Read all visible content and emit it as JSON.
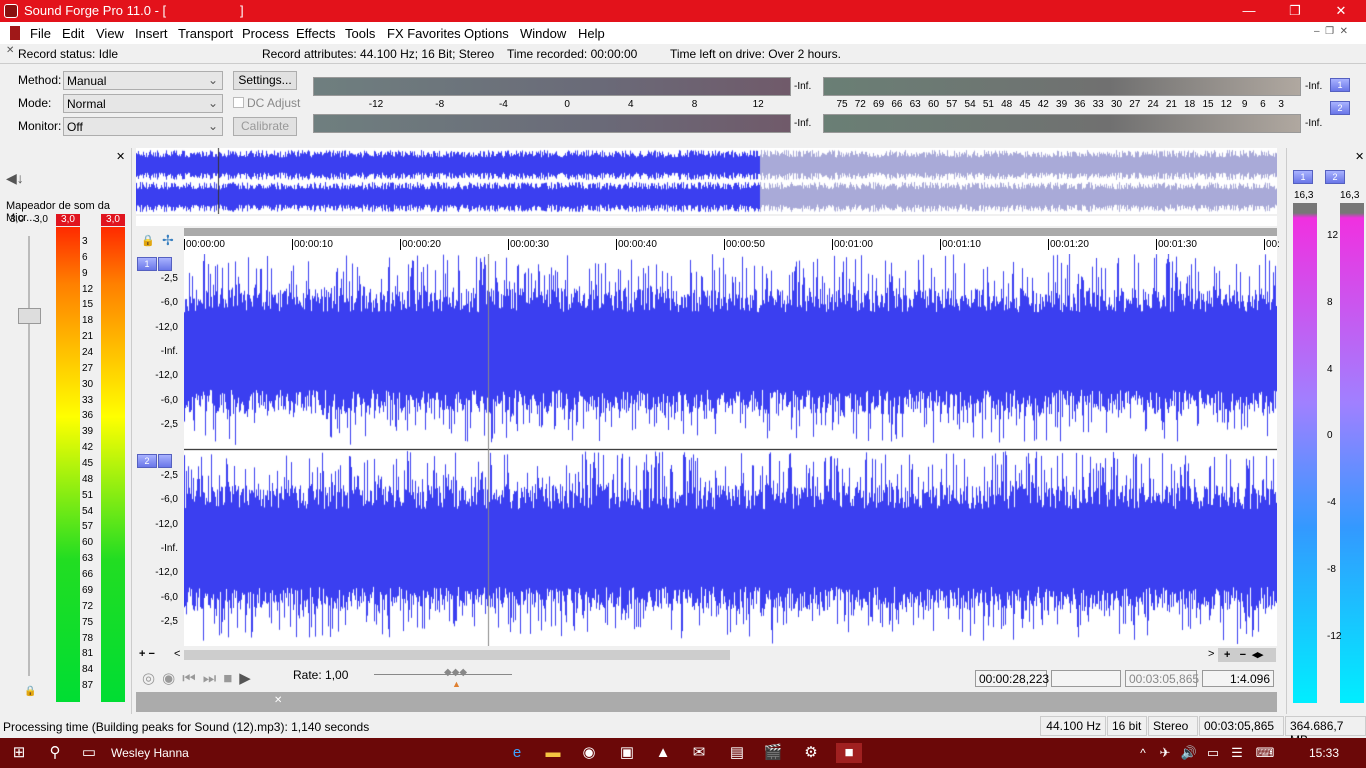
{
  "app": {
    "title": "Sound Forge Pro 11.0 - [",
    "title_end": "]",
    "icon": "sound-forge-icon"
  },
  "window_controls": {
    "minimize": "—",
    "restore": "❐",
    "close": "✕"
  },
  "menu": [
    "File",
    "Edit",
    "View",
    "Insert",
    "Transport",
    "Process",
    "Effects",
    "Tools",
    "FX Favorites",
    "Options",
    "Window",
    "Help"
  ],
  "record": {
    "status": "Record status: Idle",
    "attributes": "Record attributes: 44.100 Hz; 16 Bit; Stereo",
    "time_recorded": "Time recorded: 00:00:00",
    "time_left": "Time left on drive: Over 2 hours.",
    "method_label": "Method:",
    "method": "Manual",
    "mode_label": "Mode:",
    "mode": "Normal",
    "monitor_label": "Monitor:",
    "monitor": "Off",
    "settings": "Settings...",
    "dc_adjust": "DC Adjust",
    "calibrate": "Calibrate",
    "meter_inf": "-Inf.",
    "scale_left": [
      "-12",
      "-8",
      "-4",
      "0",
      "4",
      "8",
      "12"
    ],
    "scale_right": [
      "75",
      "72",
      "69",
      "66",
      "63",
      "60",
      "57",
      "54",
      "51",
      "48",
      "45",
      "42",
      "39",
      "36",
      "33",
      "30",
      "27",
      "24",
      "21",
      "18",
      "15",
      "12",
      "9",
      "6",
      "3"
    ],
    "channel_buttons": [
      "1",
      "2"
    ]
  },
  "left_meter": {
    "device": "Mapeador de som da Micr...",
    "values": [
      "3,0",
      "3,0"
    ],
    "peak": [
      "3,0",
      "3,0"
    ],
    "scale": [
      "3",
      "6",
      "9",
      "12",
      "15",
      "18",
      "21",
      "24",
      "27",
      "30",
      "33",
      "36",
      "39",
      "42",
      "45",
      "48",
      "51",
      "54",
      "57",
      "60",
      "63",
      "66",
      "69",
      "72",
      "75",
      "78",
      "81",
      "84",
      "87"
    ]
  },
  "right_meter": {
    "channels": [
      "1",
      "2"
    ],
    "peak": [
      "16,3",
      "16,3"
    ],
    "scale": [
      "12",
      "8",
      "4",
      "0",
      "-4",
      "-8",
      "-12"
    ]
  },
  "ruler": [
    "00:00:00",
    "00:00:10",
    "00:00:20",
    "00:00:30",
    "00:00:40",
    "00:00:50",
    "00:01:00",
    "00:01:10",
    "00:01:20",
    "00:01:30",
    "00:"
  ],
  "channels": [
    {
      "num": "1",
      "db": [
        "-2,5",
        "-6,0",
        "-12,0",
        "-Inf.",
        "-12,0",
        "-6,0",
        "-2,5"
      ]
    },
    {
      "num": "2",
      "db": [
        "-2,5",
        "-6,0",
        "-12,0",
        "-Inf.",
        "-12,0",
        "-6,0",
        "-2,5"
      ]
    }
  ],
  "wave_color": "#3b3ff0",
  "transport": {
    "rate": "Rate: 1,00",
    "cursor": "00:00:28,223",
    "selection": "",
    "length": "00:03:05,865",
    "zoom": "1:4.096"
  },
  "statusbar": {
    "message": "Processing time (Building peaks for Sound  (12).mp3): 1,140 seconds",
    "rate": "44.100 Hz",
    "bits": "16 bit",
    "channels": "Stereo",
    "length": "00:03:05,865",
    "space": "364.686,7 MB"
  },
  "taskbar": {
    "user": "Wesley Hanna",
    "time": "15:33"
  }
}
